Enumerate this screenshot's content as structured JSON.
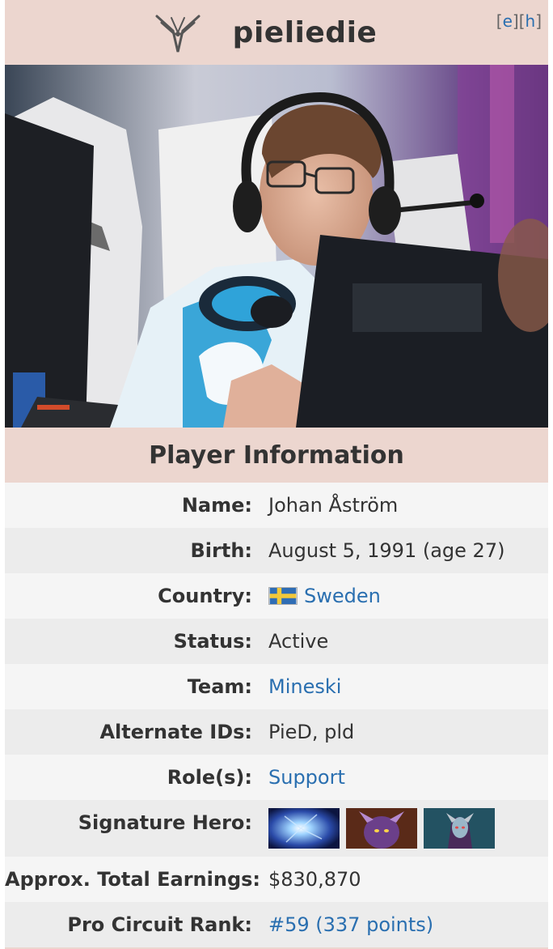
{
  "header": {
    "player_name": "pieliedie",
    "edit_open": "[",
    "edit_label": "e",
    "edit_mid": "][",
    "history_label": "h",
    "edit_close": "]"
  },
  "photo": {
    "description_icon": "player-photo"
  },
  "section": {
    "title": "Player Information"
  },
  "fields": {
    "name": {
      "label": "Name:",
      "value": "Johan Åström"
    },
    "birth": {
      "label": "Birth:",
      "value": "August 5, 1991 (age 27)"
    },
    "country": {
      "label": "Country:",
      "value": "Sweden",
      "flag_icon": "sweden-flag-icon"
    },
    "status": {
      "label": "Status:",
      "value": "Active"
    },
    "team": {
      "label": "Team:",
      "value": "Mineski"
    },
    "alternate_ids": {
      "label": "Alternate IDs:",
      "value": "PieD, pld"
    },
    "roles": {
      "label": "Role(s):",
      "value": "Support"
    },
    "signature_hero": {
      "label": "Signature Hero:",
      "heroes": [
        "hero-portrait-1",
        "hero-portrait-2",
        "hero-portrait-3"
      ]
    },
    "earnings": {
      "label": "Approx. Total Earnings:",
      "value": "$830,870"
    },
    "pro_circuit_rank": {
      "label": "Pro Circuit Rank:",
      "value": "#59 (337 points)"
    }
  },
  "colors": {
    "header_bg": "#ecd6cf",
    "link": "#2a6fb0",
    "text": "#333333"
  }
}
